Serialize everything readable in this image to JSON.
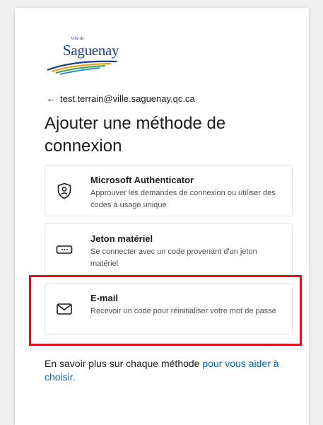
{
  "logo": {
    "small_text": "Ville de",
    "name": "Saguenay"
  },
  "account": {
    "back_icon": "arrow-left-icon",
    "email": "test.terrain@ville.saguenay.qc.ca"
  },
  "page_title": "Ajouter une méthode de connexion",
  "options": [
    {
      "icon": "authenticator-lock-icon",
      "title": "Microsoft Authenticator",
      "description": "Approuver les demandes de connexion ou utiliser des codes à usage unique"
    },
    {
      "icon": "hardware-token-icon",
      "title": "Jeton matériel",
      "description": "Se connecter avec un code provenant d'un jeton matériel"
    },
    {
      "icon": "mail-icon",
      "title": "E-mail",
      "description": "Recevoir un code pour réinitialiser votre mot de passe"
    }
  ],
  "footer": {
    "text": "En savoir plus sur chaque méthode ",
    "link": "pour vous aider à choisir."
  },
  "colors": {
    "highlight": "#e0101a",
    "link": "#0067b8",
    "brand": "#1a3c8c"
  }
}
